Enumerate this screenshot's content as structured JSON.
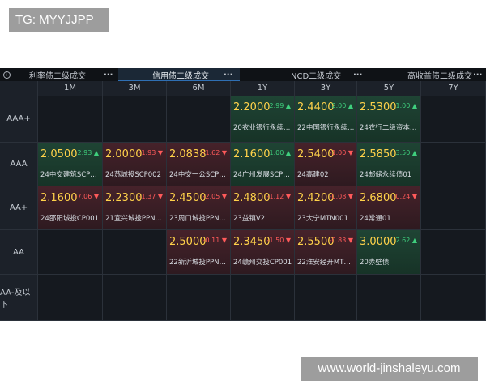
{
  "watermarks": {
    "top": "TG: MYYJJPP",
    "bottom": "www.world-jinshaleyu.com"
  },
  "tabs": [
    {
      "label": "利率债二级成交",
      "more": "···"
    },
    {
      "label": "信用债二级成交",
      "more": "···",
      "active": true
    },
    {
      "label": "NCD二级成交",
      "more": "···"
    },
    {
      "label": "高收益债二级成交",
      "more": "···"
    }
  ],
  "columns": [
    "1M",
    "3M",
    "6M",
    "1Y",
    "3Y",
    "5Y",
    "7Y"
  ],
  "rows": [
    "AAA+",
    "AAA",
    "AA+",
    "AA",
    "AA-及以下"
  ],
  "cells": [
    {
      "row": 0,
      "col": 3,
      "yield": "2.2000",
      "chg": "2.99 ▲",
      "dir": "up",
      "bond": "20农业银行永续债..."
    },
    {
      "row": 0,
      "col": 4,
      "yield": "2.4400",
      "chg": "2.00 ▲",
      "dir": "up",
      "bond": "22中国银行永续债..."
    },
    {
      "row": 0,
      "col": 5,
      "yield": "2.5300",
      "chg": "1.00 ▲",
      "dir": "up",
      "bond": "24农行二级资本债..."
    },
    {
      "row": 1,
      "col": 0,
      "yield": "2.0500",
      "chg": "2.93 ▲",
      "dir": "up",
      "bond": "24中交建筑SCP00..."
    },
    {
      "row": 1,
      "col": 1,
      "yield": "2.0000",
      "chg": "-1.93 ▼",
      "dir": "down",
      "bond": "24苏城投SCP002"
    },
    {
      "row": 1,
      "col": 2,
      "yield": "2.0838",
      "chg": "-1.62 ▼",
      "dir": "down",
      "bond": "24中交一公SCP00..."
    },
    {
      "row": 1,
      "col": 3,
      "yield": "2.1600",
      "chg": "1.00 ▲",
      "dir": "up",
      "bond": "24广州发展SCP001"
    },
    {
      "row": 1,
      "col": 4,
      "yield": "2.5400",
      "chg": "-1.00 ▼",
      "dir": "down",
      "bond": "24高建02"
    },
    {
      "row": 1,
      "col": 5,
      "yield": "2.5850",
      "chg": "3.50 ▲",
      "dir": "up",
      "bond": "24邮储永续债01"
    },
    {
      "row": 2,
      "col": 0,
      "yield": "2.1600",
      "chg": "-7.06 ▼",
      "dir": "down",
      "bond": "24邵阳城投CP001"
    },
    {
      "row": 2,
      "col": 1,
      "yield": "2.2300",
      "chg": "-1.37 ▼",
      "dir": "down",
      "bond": "21宜兴城投PPN003"
    },
    {
      "row": 2,
      "col": 2,
      "yield": "2.4500",
      "chg": "-2.05 ▼",
      "dir": "down",
      "bond": "23周口城投PPN002"
    },
    {
      "row": 2,
      "col": 3,
      "yield": "2.4800",
      "chg": "-1.12 ▼",
      "dir": "down",
      "bond": "23益镇V2"
    },
    {
      "row": 2,
      "col": 4,
      "yield": "2.4200",
      "chg": "-0.08 ▼",
      "dir": "down",
      "bond": "23大宁MTN001"
    },
    {
      "row": 2,
      "col": 5,
      "yield": "2.6800",
      "chg": "-0.24 ▼",
      "dir": "down",
      "bond": "24常通01"
    },
    {
      "row": 3,
      "col": 2,
      "yield": "2.5000",
      "chg": "-0.11 ▼",
      "dir": "down",
      "bond": "22新沂城投PPN001"
    },
    {
      "row": 3,
      "col": 3,
      "yield": "2.3450",
      "chg": "-1.50 ▼",
      "dir": "down",
      "bond": "24赣州交投CP001"
    },
    {
      "row": 3,
      "col": 4,
      "yield": "2.5500",
      "chg": "-0.83 ▼",
      "dir": "down",
      "bond": "22淮安经开MTN0..."
    },
    {
      "row": 3,
      "col": 5,
      "yield": "3.0000",
      "chg": "2.62 ▲",
      "dir": "up",
      "bond": "20赤壁债"
    }
  ],
  "colors": {
    "up": "#3fcf7d",
    "down": "#ff5a5a",
    "yield": "#ffd24a",
    "background": "#15191f"
  }
}
